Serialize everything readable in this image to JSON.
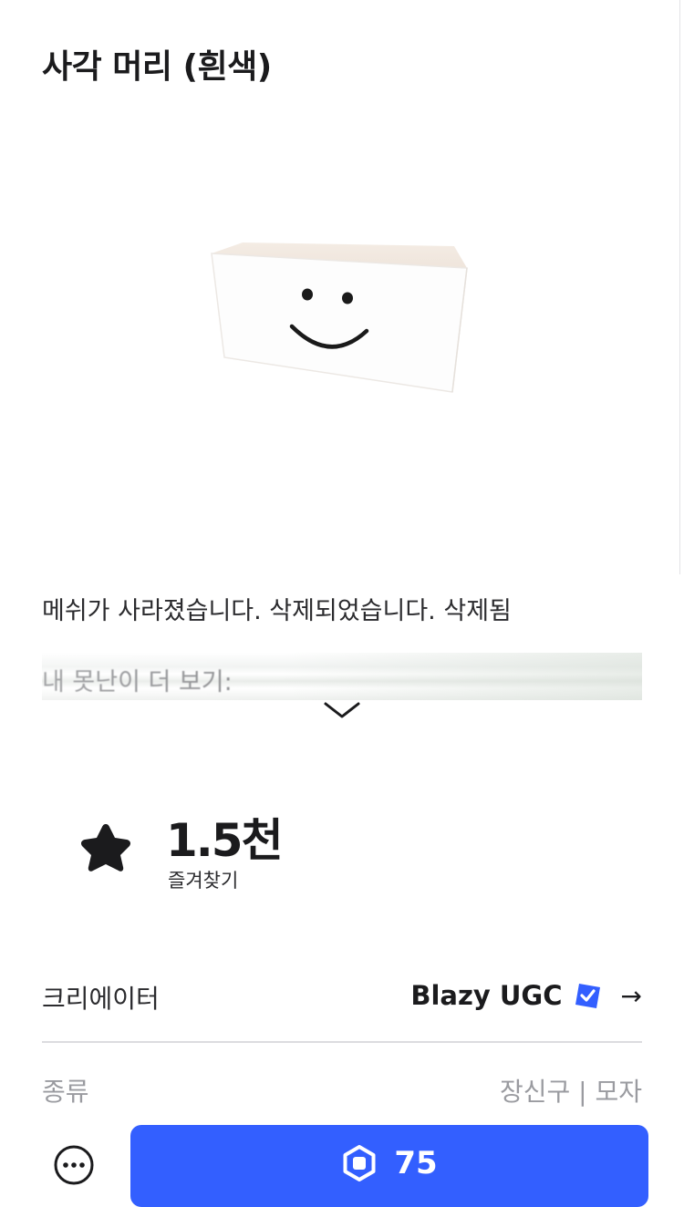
{
  "item": {
    "title": "사각 머리 (흰색)",
    "description": "메쉬가 사라졌습니다. 삭제되었습니다. 삭제됨",
    "more_preview": "내 못난이 더 보기:"
  },
  "favorites": {
    "count": "1.5천",
    "label": "즐겨찾기"
  },
  "details": {
    "creator_label": "크리에이터",
    "creator_name": "Blazy UGC",
    "type_label": "종류",
    "type_value": "장신구 | 모자"
  },
  "purchase": {
    "price": "75"
  },
  "colors": {
    "accent": "#335fff",
    "verified": "#335fff"
  },
  "icons": [
    "chevron-down-icon",
    "star-icon",
    "verified-badge-icon",
    "arrow-right-icon",
    "more-options-icon",
    "robux-icon"
  ]
}
